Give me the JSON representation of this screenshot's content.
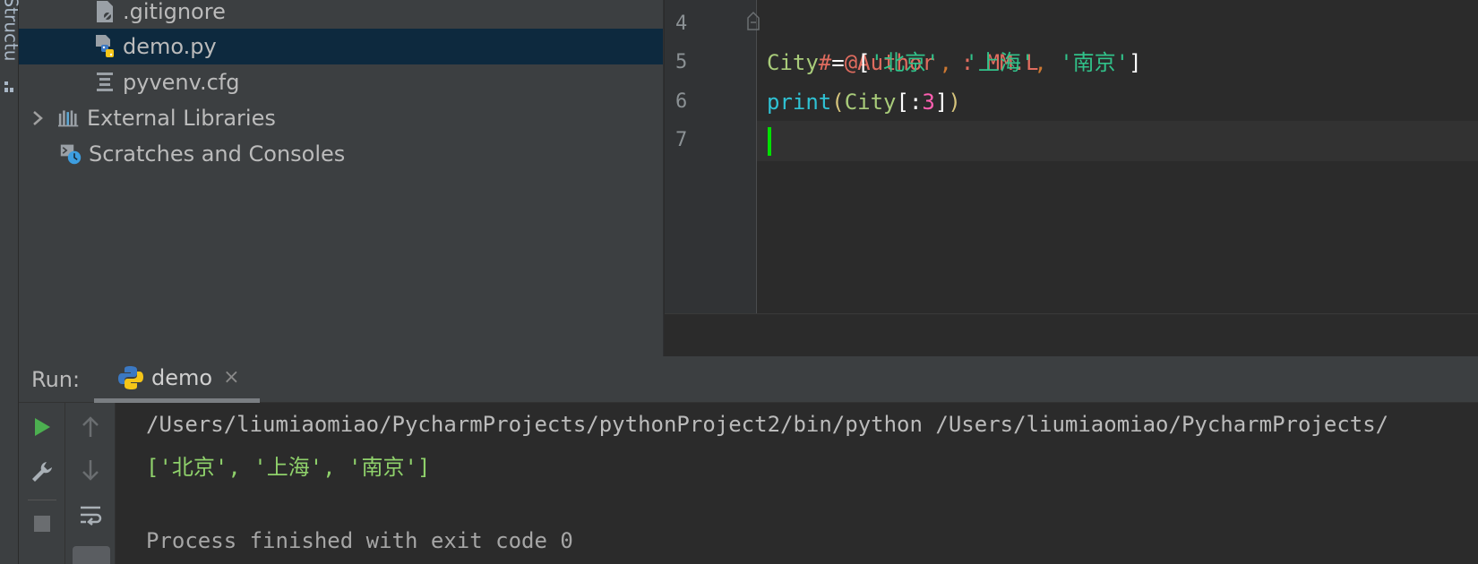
{
  "left_strip": {
    "structure_label": "Structu"
  },
  "project_tree": {
    "items": [
      {
        "label": ".gitignore",
        "icon": "gitignore-file-icon",
        "selected": false
      },
      {
        "label": "demo.py",
        "icon": "python-file-icon",
        "selected": true
      },
      {
        "label": "pyvenv.cfg",
        "icon": "config-file-icon",
        "selected": false
      },
      {
        "label": "External Libraries",
        "icon": "libraries-icon",
        "selected": false,
        "expandable": true
      },
      {
        "label": "Scratches and Consoles",
        "icon": "scratches-icon",
        "selected": false
      }
    ]
  },
  "editor": {
    "line_numbers": [
      "4",
      "5",
      "6",
      "7"
    ],
    "lines": {
      "l4": {
        "comment": "# @Author  : MM.L"
      },
      "l5": {
        "var": "City",
        "eq": " = ",
        "open": "[",
        "s1": "'北京'",
        "c1": ", ",
        "s2": "'上海'",
        "c2": ", ",
        "s3": "'南京'",
        "close": "]"
      },
      "l6": {
        "fn": "print",
        "open": "(",
        "var": "City",
        "bopen": "[:",
        "num": "3",
        "bclose": "]",
        "close": ")"
      },
      "l7": {}
    },
    "caret_color": "#00e000"
  },
  "run_panel": {
    "label": "Run:",
    "tab_label": "demo",
    "tab_close": "×",
    "console": {
      "path_line": "/Users/liumiaomiao/PycharmProjects/pythonProject2/bin/python /Users/liumiaomiao/PycharmProjects/",
      "output_line": "['北京', '上海', '南京']",
      "process_line": "Process finished with exit code 0"
    }
  },
  "colors": {
    "comment": "#e06c5f",
    "string": "#31c28a",
    "function": "#2fc2d4",
    "number": "#ff5fb1",
    "run_green": "#4caf50",
    "selection": "#0d293e"
  }
}
